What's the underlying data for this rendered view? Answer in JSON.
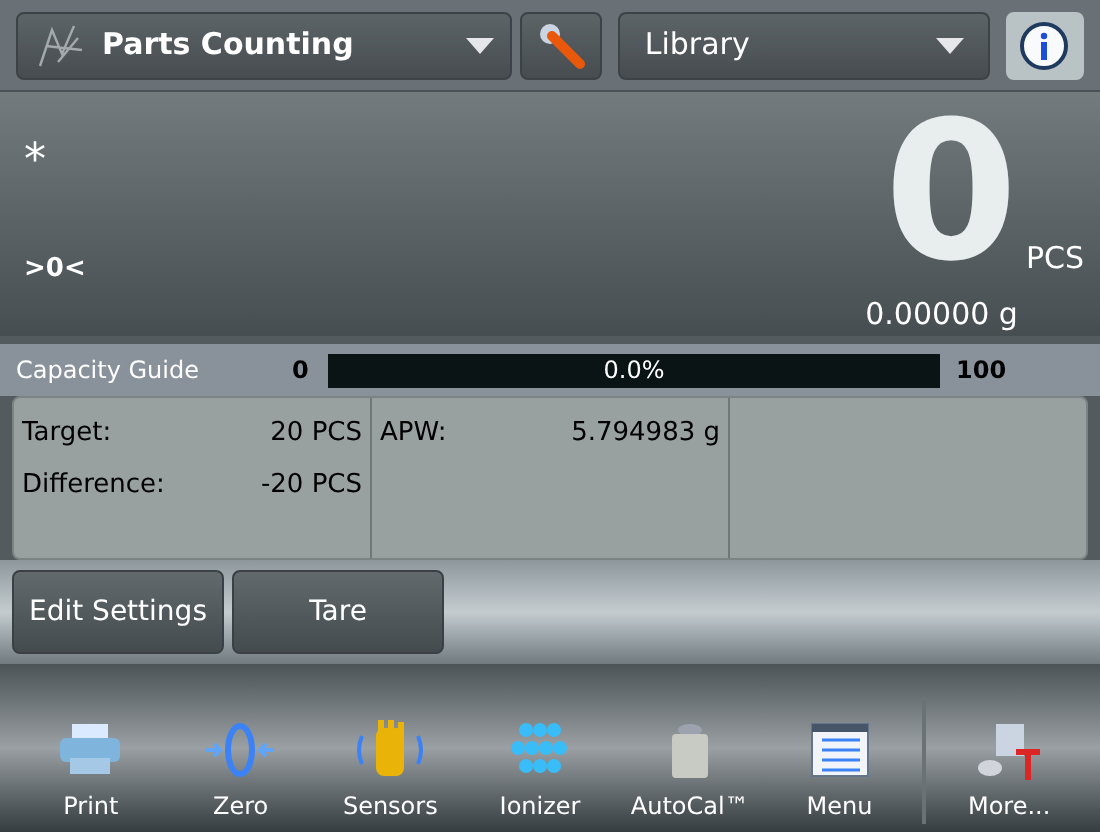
{
  "header": {
    "mode": "Parts Counting",
    "library": "Library"
  },
  "display": {
    "stable_mark": "*",
    "zero_mark": ">0<",
    "value": "0",
    "unit": "PCS",
    "weight": "0.00000 g"
  },
  "capacity_guide": {
    "label": "Capacity Guide",
    "min": "0",
    "max": "100",
    "reading": "0.0%",
    "level": 0
  },
  "info_panel": [
    {
      "rows": [
        {
          "label": "Target:",
          "value": "20 PCS"
        },
        {
          "label": "Difference:",
          "value": "-20 PCS"
        }
      ]
    },
    {
      "rows": [
        {
          "label": "APW:",
          "value": "5.794983 g"
        }
      ]
    }
  ],
  "buttons": [
    "Edit Settings",
    "Tare"
  ],
  "toolbar": [
    {
      "kind": "print",
      "label": "Print"
    },
    {
      "kind": "zero",
      "label": "Zero"
    },
    {
      "kind": "sensors",
      "label": "Sensors"
    },
    {
      "kind": "ionizer",
      "label": "Ionizer"
    },
    {
      "kind": "autocal",
      "label": "AutoCal™"
    },
    {
      "kind": "menu",
      "label": "Menu"
    },
    {
      "kind": "more",
      "label": "More..."
    }
  ]
}
